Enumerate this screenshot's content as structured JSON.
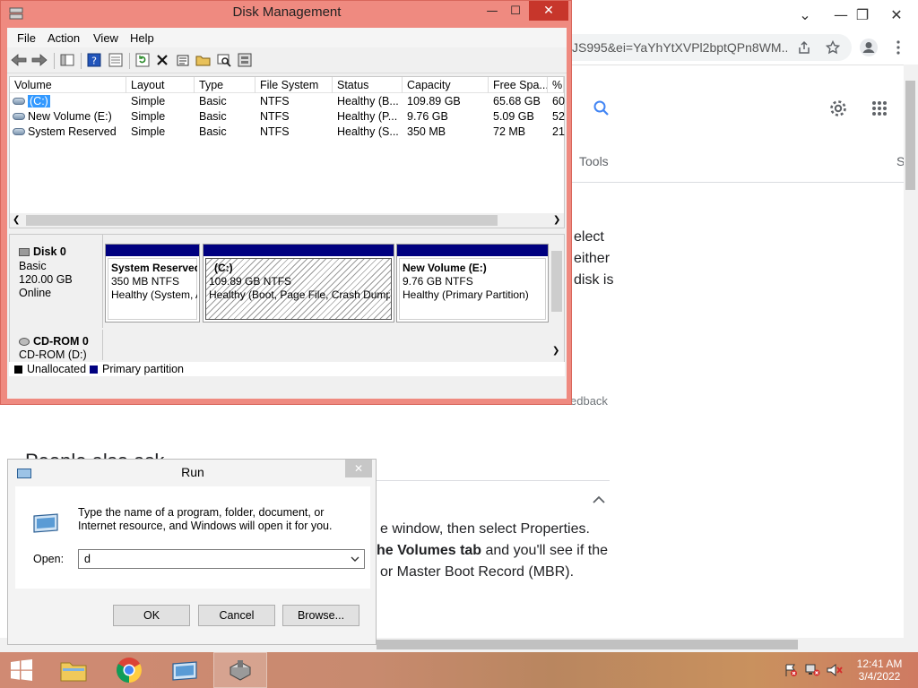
{
  "browser": {
    "url_fragment": "JS995&ei=YaYhYtXVPl2bptQPn8WM...",
    "tools_label": "Tools",
    "right_edge_letter": "S",
    "snippet_lines": [
      "elect",
      "either",
      "disk is"
    ],
    "feedback_text": "edback",
    "people_also_ask": "People also ask",
    "answer_lines": [
      "e window, then select Properties.",
      "he Volumes tab",
      " and you'll see if the",
      "or Master Boot Record (MBR)."
    ],
    "minimize_glyph": "—",
    "restore_glyph": "❐",
    "close_glyph": "✕",
    "chevron_glyph": "⌄"
  },
  "disk_management": {
    "title": "Disk Management",
    "menu": [
      "File",
      "Action",
      "View",
      "Help"
    ],
    "columns": [
      "Volume",
      "Layout",
      "Type",
      "File System",
      "Status",
      "Capacity",
      "Free Spa...",
      "% F"
    ],
    "volumes": [
      {
        "volume": "(C:)",
        "layout": "Simple",
        "type": "Basic",
        "fs": "NTFS",
        "status": "Healthy (B...",
        "capacity": "109.89 GB",
        "free": "65.68 GB",
        "pct": "60"
      },
      {
        "volume": "New Volume (E:)",
        "layout": "Simple",
        "type": "Basic",
        "fs": "NTFS",
        "status": "Healthy (P...",
        "capacity": "9.76 GB",
        "free": "5.09 GB",
        "pct": "52"
      },
      {
        "volume": "System Reserved",
        "layout": "Simple",
        "type": "Basic",
        "fs": "NTFS",
        "status": "Healthy (S...",
        "capacity": "350 MB",
        "free": "72 MB",
        "pct": "21"
      }
    ],
    "disk0": {
      "name": "Disk 0",
      "type": "Basic",
      "size": "120.00 GB",
      "state": "Online"
    },
    "partitions": [
      {
        "name": "System Reserved",
        "size": "350 MB NTFS",
        "status": "Healthy (System, A"
      },
      {
        "name": "(C:)",
        "size": "109.89 GB NTFS",
        "status": "Healthy (Boot, Page File, Crash Dump,"
      },
      {
        "name": "New Volume  (E:)",
        "size": "9.76 GB NTFS",
        "status": "Healthy (Primary Partition)"
      }
    ],
    "cdrom": {
      "name": "CD-ROM 0",
      "sub": "CD-ROM (D:)"
    },
    "legend": [
      {
        "label": "Unallocated",
        "color": "#000000"
      },
      {
        "label": "Primary partition",
        "color": "#000080"
      }
    ],
    "controls": {
      "minimize": "—",
      "maximize": "☐",
      "close": "✕"
    }
  },
  "run_dialog": {
    "title": "Run",
    "description": "Type the name of a program, folder, document, or Internet resource, and Windows will open it for you.",
    "open_label": "Open:",
    "open_value": "d",
    "buttons": {
      "ok": "OK",
      "cancel": "Cancel",
      "browse": "Browse..."
    },
    "close_glyph": "✕"
  },
  "taskbar": {
    "time": "12:41 AM",
    "date": "3/4/2022"
  },
  "colors": {
    "dm_frame": "#ef8a80",
    "dm_close": "#c7362b",
    "primary_partition": "#000080",
    "selection": "#3399ff"
  }
}
